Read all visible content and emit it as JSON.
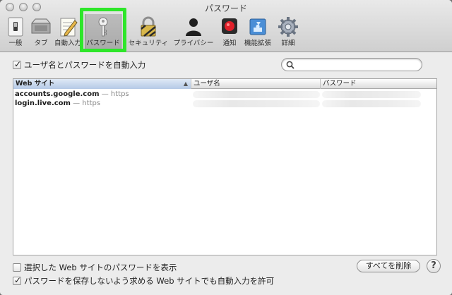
{
  "window": {
    "title": "パスワード"
  },
  "toolbar": {
    "items": [
      {
        "id": "general",
        "label": "一般",
        "icon": "light-switch-icon"
      },
      {
        "id": "tabs",
        "label": "タブ",
        "icon": "tabs-icon"
      },
      {
        "id": "autofill",
        "label": "自動入力",
        "icon": "pencil-form-icon"
      },
      {
        "id": "passwords",
        "label": "パスワード",
        "icon": "key-icon",
        "selected": true
      },
      {
        "id": "security",
        "label": "セキュリティ",
        "icon": "padlock-icon"
      },
      {
        "id": "privacy",
        "label": "プライバシー",
        "icon": "person-silhouette-icon"
      },
      {
        "id": "notifications",
        "label": "通知",
        "icon": "record-dot-icon"
      },
      {
        "id": "extensions",
        "label": "機能拡張",
        "icon": "puzzle-piece-icon"
      },
      {
        "id": "advanced",
        "label": "詳細",
        "icon": "gear-icon"
      }
    ]
  },
  "options": {
    "autofill_usernames": {
      "label": "ユーザ名とパスワードを自動入力",
      "checked": true
    },
    "show_passwords": {
      "label": "選択した Web サイトのパスワードを表示",
      "checked": false
    },
    "allow_autofill_never_save": {
      "label": "パスワードを保存しないよう求める Web サイトでも自動入力を許可",
      "checked": true
    }
  },
  "search": {
    "value": "",
    "placeholder": ""
  },
  "table": {
    "columns": [
      "Web サイト",
      "ユーザ名",
      "パスワード"
    ],
    "rows": [
      {
        "site": "accounts.google.com",
        "sep": " — ",
        "proto": "https"
      },
      {
        "site": "login.live.com",
        "sep": " — ",
        "proto": "https"
      }
    ]
  },
  "buttons": {
    "remove_all": "すべてを削除",
    "help": "?"
  },
  "colors": {
    "highlight": "#2ee62a",
    "window_bg": "#ececec"
  }
}
